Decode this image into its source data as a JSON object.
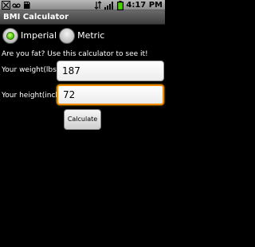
{
  "status_bar": {
    "time": "4:17 PM",
    "icons": [
      "usb-debug-icon",
      "voicemail-icon",
      "sd-card-icon",
      "network-3g-icon",
      "signal-icon",
      "battery-icon"
    ]
  },
  "app": {
    "title": "BMI Calculator"
  },
  "units": {
    "imperial_label": "Imperial",
    "metric_label": "Metric",
    "selected": "Imperial"
  },
  "question": "Are you fat? Use this calculator to see it!",
  "weight": {
    "label": "Your weight(lbs )",
    "value": "187"
  },
  "height": {
    "label": "Your height(inch)",
    "value": "72"
  },
  "calculate_label": "Calculate",
  "colors": {
    "radio_checked": "#41c200",
    "focus_border": "#f28b00",
    "title_bar": "#4a4a4a"
  }
}
